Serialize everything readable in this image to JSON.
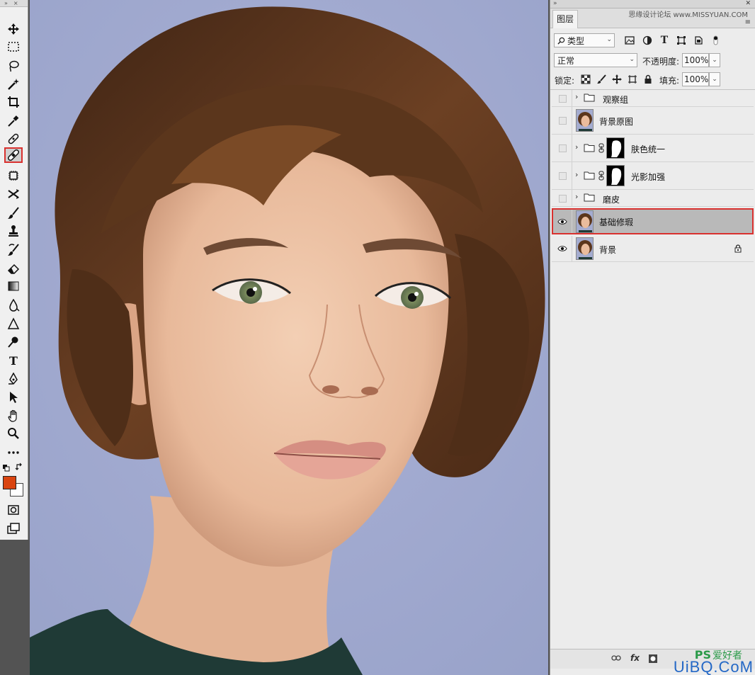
{
  "panel": {
    "tab_label": "图层",
    "watermark": "思缘设计论坛 www.MISSYUAN.COM",
    "filter": {
      "kind_label": "类型"
    },
    "blend_mode": "正常",
    "opacity_label": "不透明度:",
    "opacity_value": "100%",
    "lock_label": "锁定:",
    "fill_label": "填充:",
    "fill_value": "100%"
  },
  "layers": [
    {
      "name": "观察组",
      "type": "group",
      "visible": false
    },
    {
      "name": "背景原图",
      "type": "pixel",
      "visible": false
    },
    {
      "name": "肤色统一",
      "type": "group-mask",
      "visible": false
    },
    {
      "name": "光影加强",
      "type": "group-mask",
      "visible": false
    },
    {
      "name": "磨皮",
      "type": "group",
      "visible": false
    },
    {
      "name": "基础修瑕",
      "type": "pixel",
      "visible": true,
      "selected": true
    },
    {
      "name": "背景",
      "type": "pixel",
      "visible": true,
      "locked": true
    }
  ],
  "bottom_bar": {
    "link_icon": "link-icon",
    "fx_label": "fx"
  },
  "brand": {
    "ps": "PS",
    "ps_tail": "爱好者",
    "site": "UiBQ.CoM"
  },
  "colors": {
    "foreground": "#d94410",
    "background": "#ffffff",
    "selection_outline": "#d9312f",
    "canvas_bg": "#a3abd0"
  },
  "tools": [
    "move-tool",
    "marquee-tool",
    "lasso-tool",
    "magic-wand-tool",
    "crop-tool",
    "eyedropper-tool",
    "spot-healing-tool",
    "healing-brush-tool",
    "patch-tool",
    "content-aware-move-tool",
    "brush-tool",
    "stamp-tool",
    "history-brush-tool",
    "eraser-tool",
    "gradient-tool",
    "blur-tool",
    "dodge-tool",
    "text-tool",
    "pen-tool",
    "path-select-tool",
    "hand-tool",
    "zoom-tool",
    "more-tools"
  ]
}
